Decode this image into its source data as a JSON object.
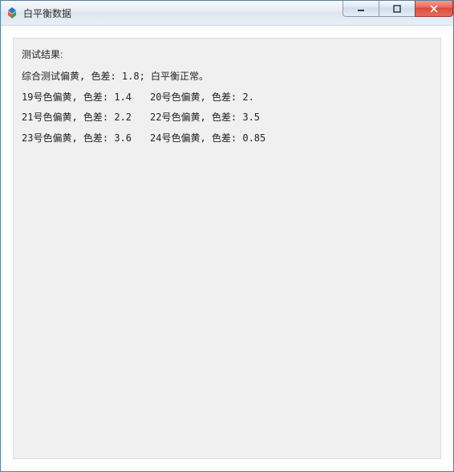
{
  "window": {
    "title": "白平衡数据",
    "shadow_text": "",
    "controls": {
      "minimize": "minimize-icon",
      "maximize": "maximize-icon",
      "close": "close-icon"
    }
  },
  "results": {
    "heading": "测试结果:",
    "summary": "综合测试偏黄, 色差: 1.8; 白平衡正常。",
    "rows": [
      {
        "left": "19号色偏黄, 色差: 1.4",
        "right": "20号色偏黄, 色差: 2."
      },
      {
        "left": "21号色偏黄, 色差: 2.2",
        "right": "22号色偏黄, 色差: 3.5"
      },
      {
        "left": "23号色偏黄, 色差: 3.6",
        "right": "24号色偏黄, 色差: 0.85"
      }
    ]
  }
}
